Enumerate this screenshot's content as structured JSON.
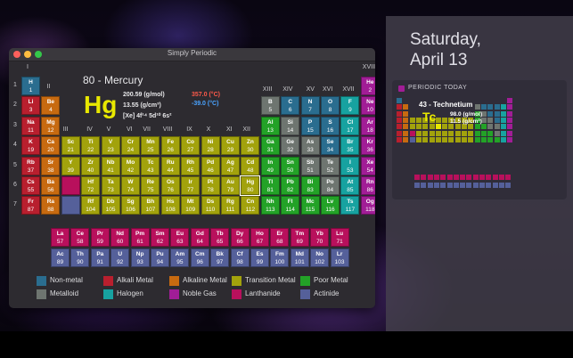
{
  "colors": {
    "nonmetal": "#2a6d8f",
    "alkali": "#b81f2e",
    "alkaline_earth": "#c76a10",
    "transition": "#a2a20c",
    "poor_metal": "#23a227",
    "metalloid": "#6e7570",
    "halogen": "#17a2a0",
    "noble_gas": "#a11d96",
    "lanthanide": "#b8105c",
    "actinide": "#55609a",
    "selected": "#e8e800"
  },
  "window": {
    "title": "Simply Periodic"
  },
  "groups": [
    "I",
    "II",
    "III",
    "IV",
    "V",
    "VI",
    "VII",
    "VIII",
    "IX",
    "X",
    "XI",
    "XII",
    "XIII",
    "XIV",
    "XV",
    "XVI",
    "XVII",
    "XVIII"
  ],
  "periods": [
    "1",
    "2",
    "3",
    "4",
    "5",
    "6",
    "7"
  ],
  "detail": {
    "name": "80 - Mercury",
    "symbol": "Hg",
    "mass": "200.59 (g/mol)",
    "density": "13.55 (g/cm³)",
    "config": "[Xe] 4f¹⁴ 5d¹⁰ 6s²",
    "melt": "357.0 (°C)",
    "boil": "-39.0 (°C)"
  },
  "elements": [
    {
      "n": 1,
      "s": "H",
      "c": "nonmetal"
    },
    {
      "n": 2,
      "s": "He",
      "c": "noble_gas"
    },
    {
      "n": 3,
      "s": "Li",
      "c": "alkali"
    },
    {
      "n": 4,
      "s": "Be",
      "c": "alkaline_earth"
    },
    {
      "n": 5,
      "s": "B",
      "c": "metalloid"
    },
    {
      "n": 6,
      "s": "C",
      "c": "nonmetal"
    },
    {
      "n": 7,
      "s": "N",
      "c": "nonmetal"
    },
    {
      "n": 8,
      "s": "O",
      "c": "nonmetal"
    },
    {
      "n": 9,
      "s": "F",
      "c": "halogen"
    },
    {
      "n": 10,
      "s": "Ne",
      "c": "noble_gas"
    },
    {
      "n": 11,
      "s": "Na",
      "c": "alkali"
    },
    {
      "n": 12,
      "s": "Mg",
      "c": "alkaline_earth"
    },
    {
      "n": 13,
      "s": "Al",
      "c": "poor_metal"
    },
    {
      "n": 14,
      "s": "Si",
      "c": "metalloid"
    },
    {
      "n": 15,
      "s": "P",
      "c": "nonmetal"
    },
    {
      "n": 16,
      "s": "S",
      "c": "nonmetal"
    },
    {
      "n": 17,
      "s": "Cl",
      "c": "halogen"
    },
    {
      "n": 18,
      "s": "Ar",
      "c": "noble_gas"
    },
    {
      "n": 19,
      "s": "K",
      "c": "alkali"
    },
    {
      "n": 20,
      "s": "Ca",
      "c": "alkaline_earth"
    },
    {
      "n": 21,
      "s": "Sc",
      "c": "transition"
    },
    {
      "n": 22,
      "s": "Ti",
      "c": "transition"
    },
    {
      "n": 23,
      "s": "V",
      "c": "transition"
    },
    {
      "n": 24,
      "s": "Cr",
      "c": "transition"
    },
    {
      "n": 25,
      "s": "Mn",
      "c": "transition"
    },
    {
      "n": 26,
      "s": "Fe",
      "c": "transition"
    },
    {
      "n": 27,
      "s": "Co",
      "c": "transition"
    },
    {
      "n": 28,
      "s": "Ni",
      "c": "transition"
    },
    {
      "n": 29,
      "s": "Cu",
      "c": "transition"
    },
    {
      "n": 30,
      "s": "Zn",
      "c": "transition"
    },
    {
      "n": 31,
      "s": "Ga",
      "c": "poor_metal"
    },
    {
      "n": 32,
      "s": "Ge",
      "c": "metalloid"
    },
    {
      "n": 33,
      "s": "As",
      "c": "metalloid"
    },
    {
      "n": 34,
      "s": "Se",
      "c": "nonmetal"
    },
    {
      "n": 35,
      "s": "Br",
      "c": "halogen"
    },
    {
      "n": 36,
      "s": "Kr",
      "c": "noble_gas"
    },
    {
      "n": 37,
      "s": "Rb",
      "c": "alkali"
    },
    {
      "n": 38,
      "s": "Sr",
      "c": "alkaline_earth"
    },
    {
      "n": 39,
      "s": "Y",
      "c": "transition"
    },
    {
      "n": 40,
      "s": "Zr",
      "c": "transition"
    },
    {
      "n": 41,
      "s": "Nb",
      "c": "transition"
    },
    {
      "n": 42,
      "s": "Mo",
      "c": "transition"
    },
    {
      "n": 43,
      "s": "Tc",
      "c": "transition"
    },
    {
      "n": 44,
      "s": "Ru",
      "c": "transition"
    },
    {
      "n": 45,
      "s": "Rh",
      "c": "transition"
    },
    {
      "n": 46,
      "s": "Pd",
      "c": "transition"
    },
    {
      "n": 47,
      "s": "Ag",
      "c": "transition"
    },
    {
      "n": 48,
      "s": "Cd",
      "c": "transition"
    },
    {
      "n": 49,
      "s": "In",
      "c": "poor_metal"
    },
    {
      "n": 50,
      "s": "Sn",
      "c": "poor_metal"
    },
    {
      "n": 51,
      "s": "Sb",
      "c": "metalloid"
    },
    {
      "n": 52,
      "s": "Te",
      "c": "metalloid"
    },
    {
      "n": 53,
      "s": "I",
      "c": "halogen"
    },
    {
      "n": 54,
      "s": "Xe",
      "c": "noble_gas"
    },
    {
      "n": 55,
      "s": "Cs",
      "c": "alkali"
    },
    {
      "n": 56,
      "s": "Ba",
      "c": "alkaline_earth"
    },
    {
      "n": "",
      "s": "",
      "c": "lanthanide"
    },
    {
      "n": 72,
      "s": "Hf",
      "c": "transition"
    },
    {
      "n": 73,
      "s": "Ta",
      "c": "transition"
    },
    {
      "n": 74,
      "s": "W",
      "c": "transition"
    },
    {
      "n": 75,
      "s": "Re",
      "c": "transition"
    },
    {
      "n": 76,
      "s": "Os",
      "c": "transition"
    },
    {
      "n": 77,
      "s": "Ir",
      "c": "transition"
    },
    {
      "n": 78,
      "s": "Pt",
      "c": "transition"
    },
    {
      "n": 79,
      "s": "Au",
      "c": "transition"
    },
    {
      "n": 80,
      "s": "Hg",
      "c": "transition",
      "sel": true
    },
    {
      "n": 81,
      "s": "Tl",
      "c": "poor_metal"
    },
    {
      "n": 82,
      "s": "Pb",
      "c": "poor_metal"
    },
    {
      "n": 83,
      "s": "Bi",
      "c": "poor_metal"
    },
    {
      "n": 84,
      "s": "Po",
      "c": "metalloid"
    },
    {
      "n": 85,
      "s": "At",
      "c": "halogen"
    },
    {
      "n": 86,
      "s": "Rn",
      "c": "noble_gas"
    },
    {
      "n": 87,
      "s": "Fr",
      "c": "alkali"
    },
    {
      "n": 88,
      "s": "Ra",
      "c": "alkaline_earth"
    },
    {
      "n": "",
      "s": "",
      "c": "actinide"
    },
    {
      "n": 104,
      "s": "Rf",
      "c": "transition"
    },
    {
      "n": 105,
      "s": "Db",
      "c": "transition"
    },
    {
      "n": 106,
      "s": "Sg",
      "c": "transition"
    },
    {
      "n": 107,
      "s": "Bh",
      "c": "transition"
    },
    {
      "n": 108,
      "s": "Hs",
      "c": "transition"
    },
    {
      "n": 109,
      "s": "Mt",
      "c": "transition"
    },
    {
      "n": 110,
      "s": "Ds",
      "c": "transition"
    },
    {
      "n": 111,
      "s": "Rg",
      "c": "transition"
    },
    {
      "n": 112,
      "s": "Cn",
      "c": "transition"
    },
    {
      "n": 113,
      "s": "Nh",
      "c": "poor_metal"
    },
    {
      "n": 114,
      "s": "Fl",
      "c": "poor_metal"
    },
    {
      "n": 115,
      "s": "Mc",
      "c": "poor_metal"
    },
    {
      "n": 116,
      "s": "Lv",
      "c": "poor_metal"
    },
    {
      "n": 117,
      "s": "Ts",
      "c": "halogen"
    },
    {
      "n": 118,
      "s": "Og",
      "c": "noble_gas"
    }
  ],
  "lanthanides": [
    {
      "n": 57,
      "s": "La"
    },
    {
      "n": 58,
      "s": "Ce"
    },
    {
      "n": 59,
      "s": "Pr"
    },
    {
      "n": 60,
      "s": "Nd"
    },
    {
      "n": 61,
      "s": "Pm"
    },
    {
      "n": 62,
      "s": "Sm"
    },
    {
      "n": 63,
      "s": "Eu"
    },
    {
      "n": 64,
      "s": "Gd"
    },
    {
      "n": 65,
      "s": "Tb"
    },
    {
      "n": 66,
      "s": "Dy"
    },
    {
      "n": 67,
      "s": "Ho"
    },
    {
      "n": 68,
      "s": "Er"
    },
    {
      "n": 69,
      "s": "Tm"
    },
    {
      "n": 70,
      "s": "Yb"
    },
    {
      "n": 71,
      "s": "Lu"
    }
  ],
  "actinides": [
    {
      "n": 89,
      "s": "Ac"
    },
    {
      "n": 90,
      "s": "Th"
    },
    {
      "n": 91,
      "s": "Pa"
    },
    {
      "n": 92,
      "s": "U"
    },
    {
      "n": 93,
      "s": "Np"
    },
    {
      "n": 94,
      "s": "Pu"
    },
    {
      "n": 95,
      "s": "Am"
    },
    {
      "n": 96,
      "s": "Cm"
    },
    {
      "n": 97,
      "s": "Bk"
    },
    {
      "n": 98,
      "s": "Cf"
    },
    {
      "n": 99,
      "s": "Es"
    },
    {
      "n": 100,
      "s": "Fm"
    },
    {
      "n": 101,
      "s": "Md"
    },
    {
      "n": 102,
      "s": "No"
    },
    {
      "n": 103,
      "s": "Lr"
    }
  ],
  "legend": [
    {
      "label": "Non-metal",
      "c": "nonmetal"
    },
    {
      "label": "Alkali Metal",
      "c": "alkali"
    },
    {
      "label": "Alkaline Metal",
      "c": "alkaline_earth"
    },
    {
      "label": "Transition Metal",
      "c": "transition"
    },
    {
      "label": "Poor Metal",
      "c": "poor_metal"
    },
    {
      "label": "Metalloid",
      "c": "metalloid"
    },
    {
      "label": "Halogen",
      "c": "halogen"
    },
    {
      "label": "Noble Gas",
      "c": "noble_gas"
    },
    {
      "label": "Lanthanide",
      "c": "lanthanide"
    },
    {
      "label": "Actinide",
      "c": "actinide"
    }
  ],
  "notification": {
    "day": "Saturday,",
    "date": "April 13",
    "widget_title": "PERIODIC TODAY",
    "name": "43 - Technetium",
    "symbol": "Tc",
    "mass": "98.0 (g/mol)",
    "density": "11.5 (g/cm³)"
  }
}
